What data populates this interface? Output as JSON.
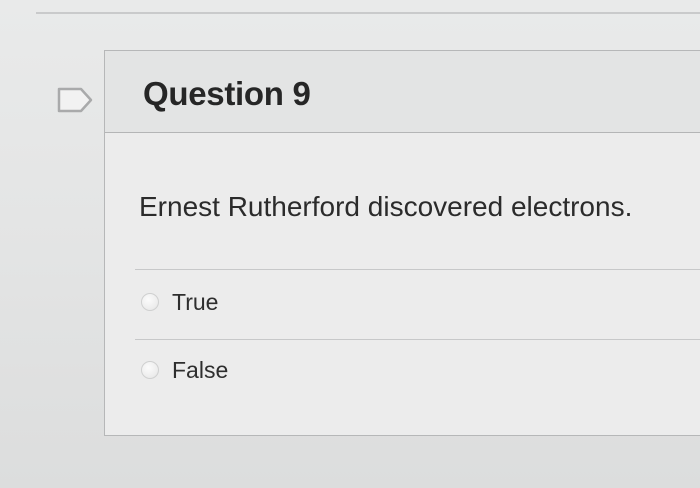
{
  "question": {
    "title": "Question 9",
    "text": "Ernest Rutherford discovered electrons.",
    "options": [
      {
        "label": "True",
        "selected": false
      },
      {
        "label": "False",
        "selected": false
      }
    ]
  },
  "icons": {
    "flag": "flag-question-icon",
    "radio": "radio-button-icon"
  },
  "colors": {
    "background": "#e6e7e7",
    "header_background": "#e3e4e4",
    "border": "#b6b7b8",
    "text": "#2b2b2b"
  }
}
